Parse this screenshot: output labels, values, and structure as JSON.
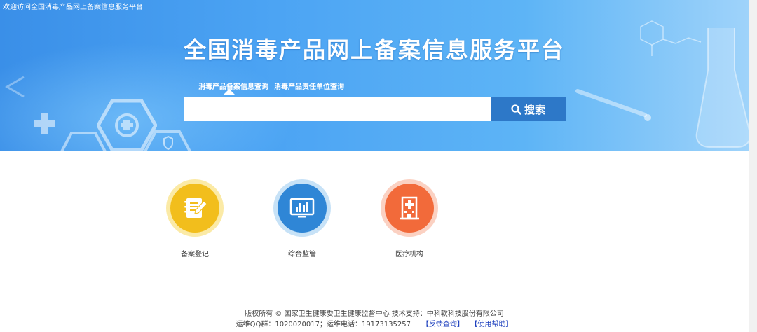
{
  "header": {
    "welcome": "欢迎访问全国消毒产品网上备案信息服务平台",
    "title": "全国消毒产品网上备案信息服务平台"
  },
  "search": {
    "tabs": [
      "消毒产品备案信息查询",
      "消毒产品责任单位查询"
    ],
    "active_tab": 0,
    "placeholder": "",
    "value": "",
    "button_label": "搜索"
  },
  "features": [
    {
      "label": "备案登记",
      "icon": "notebook-pen-icon",
      "color": "#f2be1c",
      "ring": "#fbeaa6"
    },
    {
      "label": "综合监管",
      "icon": "monitor-chart-icon",
      "color": "#2f86d6",
      "ring": "#c7e2f7"
    },
    {
      "label": "医疗机构",
      "icon": "hospital-icon",
      "color": "#f26a3a",
      "ring": "#fbd1c2"
    }
  ],
  "footer": {
    "copyright": "版权所有 © 国家卫生健康委卫生健康监督中心  技术支持：中科软科技股份有限公司",
    "contact": "运维QQ群：1020020017；运维电话：19173135257",
    "feedback_link": "【反馈查询】",
    "help_link": "【使用帮助】"
  },
  "colors": {
    "banner_start": "#3a8fe8",
    "banner_end": "#9fd3fa",
    "search_button": "#2d78c8",
    "link": "#1a3dbd"
  }
}
